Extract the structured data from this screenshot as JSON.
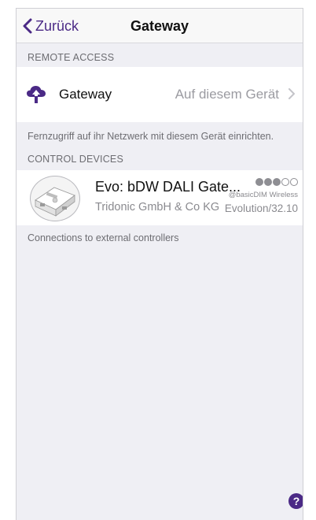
{
  "navbar": {
    "back_label": "Zurück",
    "title": "Gateway"
  },
  "remote_access": {
    "header": "REMOTE ACCESS",
    "gateway_label": "Gateway",
    "gateway_value": "Auf diesem Gerät",
    "footer": "Fernzugriff auf ihr Netzwerk mit diesem Gerät einrichten."
  },
  "control_devices": {
    "header": "CONTROL DEVICES",
    "device": {
      "name": "Evo: bDW DALI Gate...",
      "vendor": "Tridonic GmbH & Co KG",
      "protocol": "@basicDIM Wireless",
      "version": "Evolution/32.10",
      "signal_strength": 3,
      "signal_max": 5
    },
    "footer": "Connections to external controllers"
  },
  "help": {
    "label": "?"
  },
  "colors": {
    "accent": "#4b2a86",
    "background": "#efeff4",
    "secondary_text": "#8a8a8f"
  },
  "icons": {
    "back": "chevron-left-icon",
    "gateway": "cloud-upload-icon",
    "disclosure": "chevron-right-icon",
    "help": "help-icon"
  }
}
